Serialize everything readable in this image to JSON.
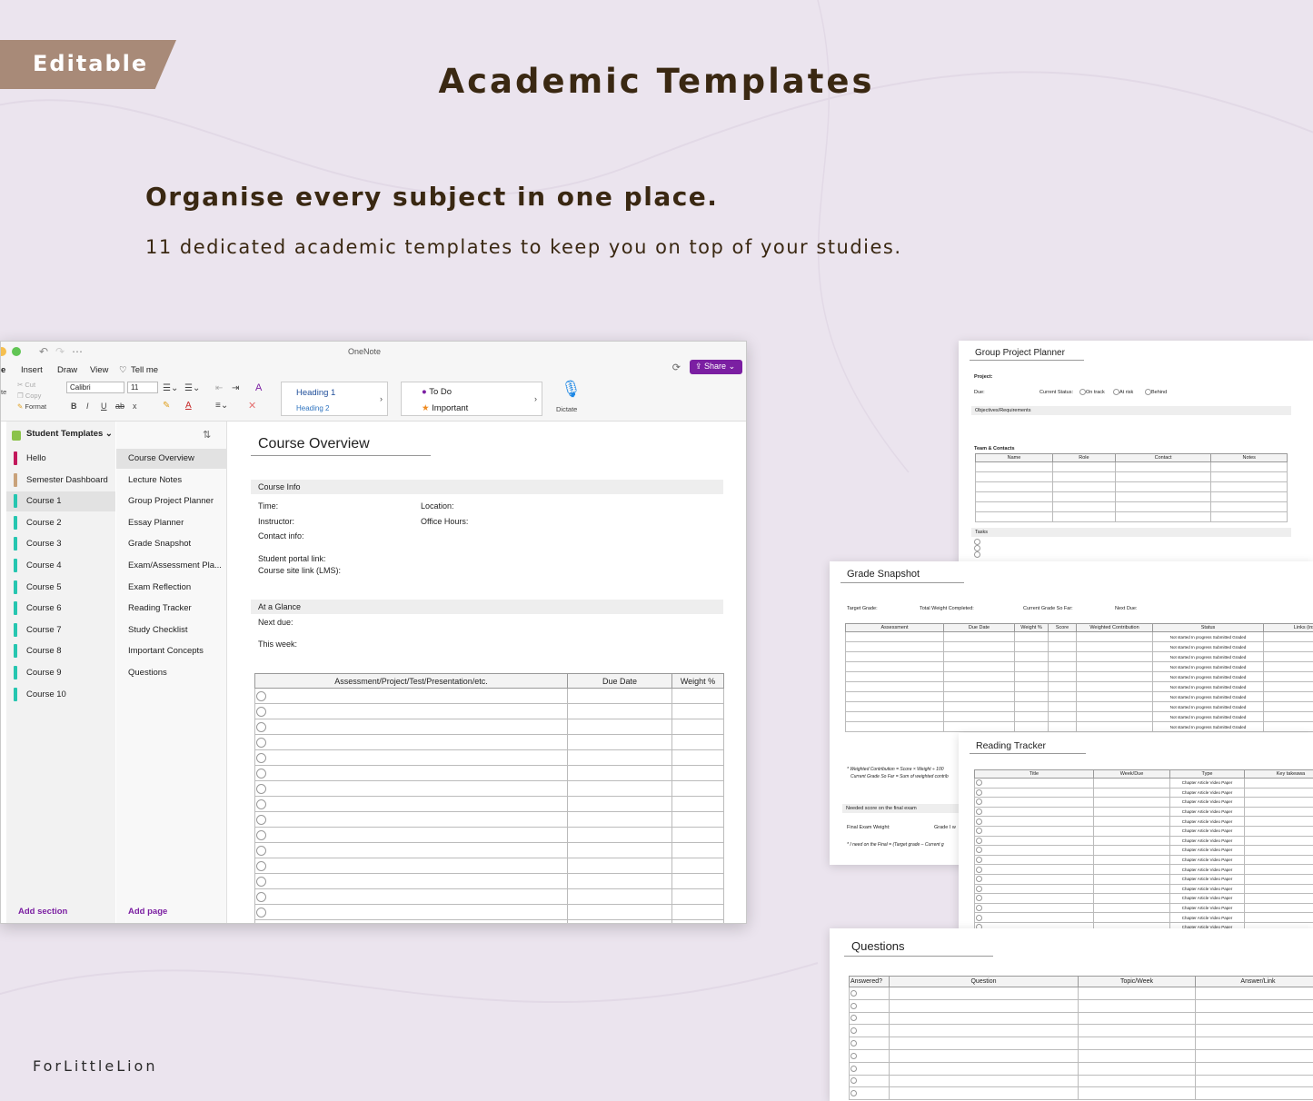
{
  "banner": {
    "badge": "Editable",
    "title": "Academic Templates",
    "headline": "Organise every subject in one place.",
    "subline": "11 dedicated academic templates to keep you on top of your studies.",
    "brand": "ForLittleLion"
  },
  "onenote": {
    "app_name": "OneNote",
    "tabs": [
      "e",
      "Insert",
      "Draw",
      "View",
      "Tell me"
    ],
    "share_label": "Share",
    "clipboard": {
      "cut": "Cut",
      "copy": "Copy",
      "format": "Format",
      "paste_stub": "te"
    },
    "font": "Calibri",
    "font_size": "11",
    "styles": {
      "h1": "Heading 1",
      "h2": "Heading 2"
    },
    "tags": {
      "todo": "To Do",
      "important": "Important"
    },
    "dictate": "Dictate",
    "format_buttons": {
      "bold": "B",
      "italic": "I",
      "underline": "U",
      "strike": "ab",
      "subscript": "x",
      "font_color": "A"
    },
    "notebook": "Student Templates",
    "sections": [
      {
        "label": "Hello",
        "color": "#c2185b"
      },
      {
        "label": "Semester Dashboard",
        "color": "#c9a27a"
      },
      {
        "label": "Course 1",
        "color": "#26c6b0"
      },
      {
        "label": "Course 2",
        "color": "#26c6b0"
      },
      {
        "label": "Course 3",
        "color": "#26c6b0"
      },
      {
        "label": "Course 4",
        "color": "#26c6b0"
      },
      {
        "label": "Course 5",
        "color": "#26c6b0"
      },
      {
        "label": "Course 6",
        "color": "#26c6b0"
      },
      {
        "label": "Course 7",
        "color": "#26c6b0"
      },
      {
        "label": "Course 8",
        "color": "#26c6b0"
      },
      {
        "label": "Course 9",
        "color": "#26c6b0"
      },
      {
        "label": "Course 10",
        "color": "#26c6b0"
      }
    ],
    "selected_section": "Course 1",
    "pages": [
      "Course Overview",
      "Lecture Notes",
      "Group Project Planner",
      "Essay Planner",
      "Grade Snapshot",
      "Exam/Assessment Pla...",
      "Exam Reflection",
      "Reading Tracker",
      "Study Checklist",
      "Important Concepts",
      "Questions"
    ],
    "selected_page": "Course Overview",
    "add_section": "Add section",
    "add_page": "Add page",
    "page": {
      "title": "Course Overview",
      "course_info": "Course Info",
      "time": "Time:",
      "location": "Location:",
      "instructor": "Instructor:",
      "office_hours": "Office Hours:",
      "contact": "Contact info:",
      "portal": "Student portal link:",
      "lms": "Course site link (LMS):",
      "glance": "At a Glance",
      "next_due": "Next due:",
      "this_week": "This week:",
      "table_headers": [
        "Assessment/Project/Test/Presentation/etc.",
        "Due Date",
        "Weight %"
      ]
    }
  },
  "sheets": {
    "group_project": {
      "title": "Group Project Planner",
      "project": "Project:",
      "due": "Due:",
      "status": "Current Status:",
      "status_options": [
        "On track",
        "At risk",
        "Behind"
      ],
      "objectives": "Objectives/Requirements",
      "team": "Team & Contacts",
      "headers": [
        "Name",
        "Role",
        "Contact",
        "Notes"
      ],
      "tasks": "Tasks"
    },
    "grade_snapshot": {
      "title": "Grade Snapshot",
      "target": "Target Grade:",
      "total_weight": "Total Weight Completed:",
      "current": "Current Grade So Far:",
      "next_due": "Next Due:",
      "headers": [
        "Assessment",
        "Due Date",
        "Weight %",
        "Score",
        "Weighted Contribution",
        "Status",
        "Links (instruc"
      ],
      "status_options": "Not started   In progress   Submitted   Graded",
      "note1": "* Weighted Contribution = Score × Weight ÷ 100",
      "note2": "Current Grade So Far = Sum of weighted contrib",
      "needed": "Needed score on the final exam",
      "final_weight": "Final Exam Weight:",
      "grade_i": "Grade I w",
      "formula": "* I need on the Final = (Target grade – Current g"
    },
    "reading_tracker": {
      "title": "Reading Tracker",
      "headers": [
        "Title",
        "Week/Due",
        "Type",
        "Key takeawa"
      ],
      "type_options": "Chapter  Article  Video  Paper"
    },
    "questions": {
      "title": "Questions",
      "headers": [
        "Answered?",
        "Question",
        "Topic/Week",
        "Answer/Link"
      ]
    }
  }
}
